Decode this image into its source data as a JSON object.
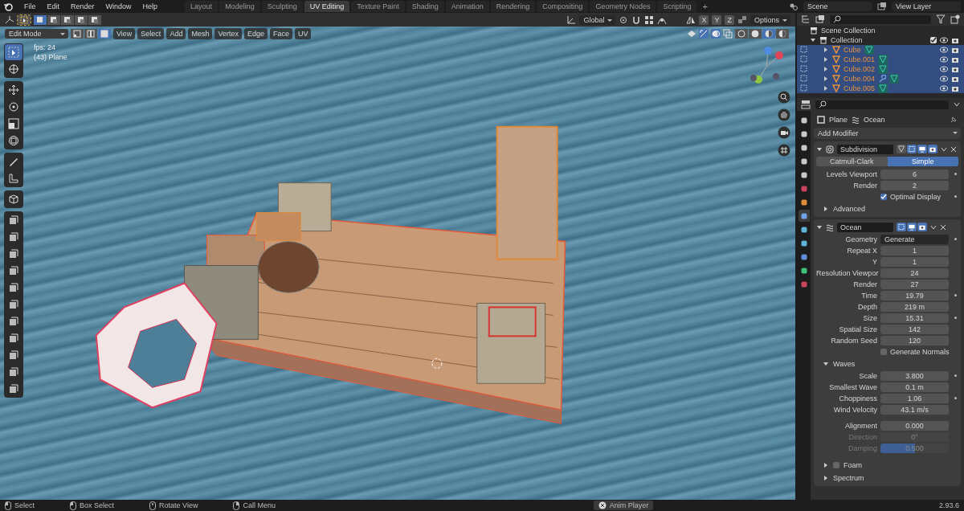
{
  "top_bar": {
    "menus": [
      "File",
      "Edit",
      "Render",
      "Window",
      "Help"
    ],
    "workspaces": [
      {
        "label": "Layout",
        "selected": false
      },
      {
        "label": "Modeling",
        "selected": false
      },
      {
        "label": "Sculpting",
        "selected": false
      },
      {
        "label": "UV Editing",
        "selected": true
      },
      {
        "label": "Texture Paint",
        "selected": false
      },
      {
        "label": "Shading",
        "selected": false
      },
      {
        "label": "Animation",
        "selected": false
      },
      {
        "label": "Rendering",
        "selected": false
      },
      {
        "label": "Compositing",
        "selected": false
      },
      {
        "label": "Geometry Nodes",
        "selected": false
      },
      {
        "label": "Scripting",
        "selected": false
      }
    ],
    "add_workspace": "+",
    "scene": "Scene",
    "view_layer": "View Layer"
  },
  "tool_header": {
    "select_box": {
      "selected": true
    },
    "select_modes": [
      {
        "selected": true
      },
      {
        "selected": false
      },
      {
        "selected": false
      },
      {
        "selected": false
      },
      {
        "selected": false
      }
    ],
    "orientation": "Global",
    "axes": [
      {
        "label": "X",
        "selected": false
      },
      {
        "label": "Y",
        "selected": false
      },
      {
        "label": "Z",
        "selected": false
      }
    ],
    "options": "Options"
  },
  "viewport": {
    "mode": "Edit Mode",
    "select_modes": [
      {
        "selected": false
      },
      {
        "selected": false
      },
      {
        "selected": true
      }
    ],
    "menus": [
      "View",
      "Select",
      "Add",
      "Mesh",
      "Vertex",
      "Edge",
      "Face",
      "UV"
    ],
    "shading_modes": [
      {
        "selected": false
      },
      {
        "selected": false
      },
      {
        "selected": true
      },
      {
        "selected": false
      }
    ],
    "fps": "fps: 24",
    "object": "(43) Plane",
    "tool_groups": [
      [
        {
          "kind": "select",
          "selected": true
        },
        {
          "kind": "cursor",
          "selected": false
        }
      ],
      [
        {
          "kind": "move",
          "selected": false
        },
        {
          "kind": "rotate",
          "selected": false
        },
        {
          "kind": "scale",
          "selected": false
        },
        {
          "kind": "transform",
          "selected": false
        }
      ],
      [
        {
          "kind": "annotate",
          "selected": false
        },
        {
          "kind": "measure",
          "selected": false
        }
      ],
      [
        {
          "kind": "add-cube",
          "selected": false
        }
      ],
      [
        {
          "kind": "extrude",
          "selected": false
        },
        {
          "kind": "inset",
          "selected": false
        },
        {
          "kind": "bevel",
          "selected": false
        },
        {
          "kind": "loop-cut",
          "selected": false
        },
        {
          "kind": "knife",
          "selected": false
        },
        {
          "kind": "poly-build",
          "selected": false
        },
        {
          "kind": "spin",
          "selected": false
        },
        {
          "kind": "smooth",
          "selected": false
        },
        {
          "kind": "shrink",
          "selected": false
        },
        {
          "kind": "shear",
          "selected": false
        },
        {
          "kind": "rip",
          "selected": false
        }
      ]
    ]
  },
  "outliner": {
    "root": "Scene Collection",
    "collections": [
      {
        "name": "Collection",
        "expanded": true,
        "checked": true,
        "children": [
          {
            "name": "Cube",
            "selected": true,
            "wrench": false
          },
          {
            "name": "Cube.001",
            "selected": true,
            "wrench": false
          },
          {
            "name": "Cube.002",
            "selected": true,
            "wrench": false
          },
          {
            "name": "Cube.004",
            "selected": true,
            "wrench": true
          },
          {
            "name": "Cube.005",
            "selected": true,
            "wrench": false
          }
        ]
      }
    ]
  },
  "properties": {
    "tabs": [
      {
        "kind": "tool",
        "selected": false
      },
      {
        "kind": "render",
        "selected": false
      },
      {
        "kind": "output",
        "selected": false
      },
      {
        "kind": "view-layer",
        "selected": false
      },
      {
        "kind": "scene",
        "selected": false
      },
      {
        "kind": "world",
        "selected": false
      },
      {
        "kind": "object",
        "selected": false
      },
      {
        "kind": "modifier",
        "selected": true
      },
      {
        "kind": "particles",
        "selected": false
      },
      {
        "kind": "physics",
        "selected": false
      },
      {
        "kind": "constraints",
        "selected": false
      },
      {
        "kind": "data",
        "selected": false
      },
      {
        "kind": "material",
        "selected": false
      }
    ],
    "object": "Plane",
    "modifier": "Ocean",
    "add_modifier": "Add Modifier",
    "modifiers": [
      {
        "kind": "subdivision",
        "name": "Subdivision",
        "expanded": true,
        "show_editmode": true,
        "show_viewport": true,
        "show_render": true,
        "fields": [
          {
            "kind": "toggle",
            "options": [
              {
                "label": "Catmull-Clark",
                "selected": false
              },
              {
                "label": "Simple",
                "selected": true
              }
            ]
          },
          {
            "kind": "number",
            "label": "Levels Viewport",
            "value": "6",
            "keyframe": true,
            "disabled": false
          },
          {
            "kind": "number",
            "label": "Render",
            "value": "2",
            "keyframe": false,
            "disabled": false
          },
          {
            "kind": "checkbox",
            "label": "Optimal Display",
            "checked": true,
            "keyframe": true
          }
        ],
        "subpanels": [
          {
            "label": "Advanced",
            "expanded": false
          }
        ]
      },
      {
        "kind": "ocean",
        "name": "Ocean",
        "expanded": true,
        "show_editmode": true,
        "show_viewport": true,
        "show_render": true,
        "fields": [
          {
            "kind": "dropdown",
            "label": "Geometry",
            "value": "Generate",
            "keyframe": true,
            "disabled": false
          },
          {
            "kind": "number",
            "label": "Repeat X",
            "value": "1",
            "keyframe": false,
            "disabled": false
          },
          {
            "kind": "number",
            "label": "Y",
            "value": "1",
            "keyframe": false,
            "disabled": false
          },
          {
            "kind": "number",
            "label": "Resolution Viewpor",
            "value": "24",
            "keyframe": false,
            "disabled": false
          },
          {
            "kind": "number",
            "label": "Render",
            "value": "27",
            "keyframe": false,
            "disabled": false
          },
          {
            "kind": "number",
            "label": "Time",
            "value": "19.79",
            "keyframe": true,
            "disabled": false
          },
          {
            "kind": "number",
            "label": "Depth",
            "value": "219 m",
            "keyframe": false,
            "disabled": false
          },
          {
            "kind": "number",
            "label": "Size",
            "value": "15.31",
            "keyframe": true,
            "disabled": false
          },
          {
            "kind": "number",
            "label": "Spatial Size",
            "value": "142",
            "keyframe": false,
            "disabled": false
          },
          {
            "kind": "number",
            "label": "Random Seed",
            "value": "120",
            "keyframe": false,
            "disabled": false
          },
          {
            "kind": "checkbox",
            "label": "Generate Normals",
            "checked": false,
            "keyframe": false
          }
        ],
        "subpanels": [
          {
            "label": "Waves",
            "expanded": true,
            "groups": [
              [
                {
                  "kind": "number",
                  "label": "Scale",
                  "value": "3.800",
                  "keyframe": true,
                  "disabled": false
                },
                {
                  "kind": "number",
                  "label": "Smallest Wave",
                  "value": "0.1 m",
                  "keyframe": false,
                  "disabled": false
                },
                {
                  "kind": "number",
                  "label": "Choppiness",
                  "value": "1.06",
                  "keyframe": true,
                  "disabled": false
                },
                {
                  "kind": "number",
                  "label": "Wind Velocity",
                  "value": "43.1 m/s",
                  "keyframe": false,
                  "disabled": false
                }
              ],
              [
                {
                  "kind": "number",
                  "label": "Alignment",
                  "value": "0.000",
                  "keyframe": false,
                  "disabled": false
                },
                {
                  "kind": "number",
                  "label": "Direction",
                  "value": "0°",
                  "keyframe": false,
                  "disabled": true
                },
                {
                  "kind": "slider",
                  "label": "Damping",
                  "value": "0.500",
                  "level": 0.5,
                  "keyframe": false,
                  "disabled": true
                }
              ]
            ]
          },
          {
            "label": "Foam",
            "expanded": false,
            "checked": false
          },
          {
            "label": "Spectrum",
            "expanded": false
          }
        ]
      }
    ]
  },
  "status_bar": {
    "hints": [
      {
        "kind": "left-mouse",
        "label": "Select"
      },
      {
        "kind": "left-mouse",
        "label": "Box Select"
      },
      {
        "kind": "middle-mouse",
        "label": "Rotate View"
      },
      {
        "kind": "right-mouse",
        "label": "Call Menu"
      }
    ],
    "anim_player": "Anim Player",
    "version": "2.93.6"
  }
}
